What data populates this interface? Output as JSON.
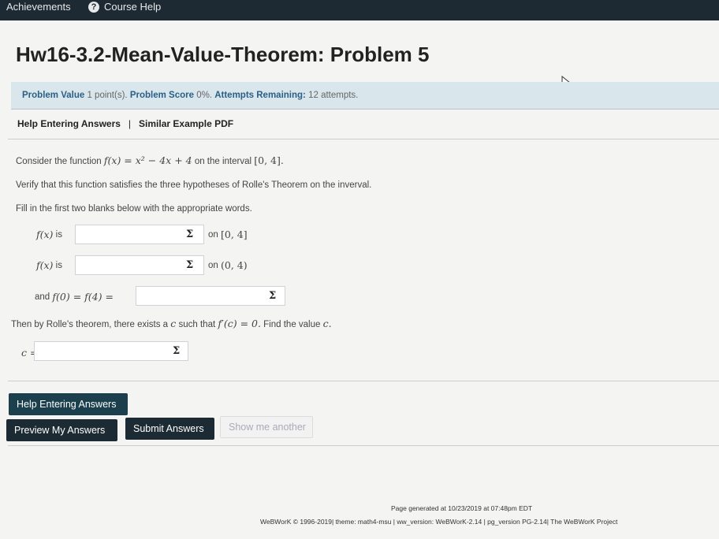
{
  "topnav": {
    "achievements": "Achievements",
    "course_help": "Course Help"
  },
  "problem": {
    "title": "Hw16-3.2-Mean-Value-Theorem: Problem 5",
    "value_label": "Problem Value",
    "value_text": "1 point(s).",
    "score_label": "Problem Score",
    "score_text": "0%.",
    "attempts_label": "Attempts Remaining:",
    "attempts_text": "12 attempts."
  },
  "help_links": {
    "help_entering": "Help Entering Answers",
    "separator": "|",
    "similar_example": "Similar Example PDF"
  },
  "body_text": {
    "consider": "Consider the function",
    "function_expr": "f(x) = x² − 4x + 4",
    "on_the_interval": "on the interval",
    "interval": "[0, 4].",
    "verify": "Verify that this function satisfies the three hypotheses of Rolle's Theorem on the inverval.",
    "fill_in": "Fill in the first two blanks below with the appropriate words.",
    "then_prefix": "Then by Rolle's theorem, there exists a",
    "then_c": "c",
    "then_mid": "such that",
    "then_eq": "f′(c) = 0.",
    "then_suffix": "Find the value",
    "then_c_end": "c."
  },
  "answers": {
    "row1_fx": "f(x)",
    "row1_is": "is",
    "row1_on": "on",
    "row1_interval": "[0, 4]",
    "row2_fx": "f(x)",
    "row2_is": "is",
    "row2_on": "on",
    "row2_interval": "(0, 4)",
    "row3_and": "and",
    "row3_expr": "f(0) = f(4) =",
    "row4_c": "c =",
    "sigma": "Σ",
    "value1": "",
    "value2": "",
    "value3": "",
    "value4": ""
  },
  "buttons": {
    "help_entering": "Help Entering Answers",
    "preview": "Preview My Answers",
    "submit": "Submit Answers",
    "show_another": "Show me another"
  },
  "footer": {
    "generated": "Page generated at 10/23/2019 at 07:48pm EDT",
    "credits": "WeBWorK © 1996-2019| theme: math4-msu | ww_version: WeBWorK-2.14 | pg_version PG-2.14| The WeBWorK Project"
  },
  "colors": {
    "topbar": "#1d2a33",
    "info_background": "#d9e6ec",
    "info_labels": "#2b5f85",
    "buttons": "#1c2b33"
  }
}
